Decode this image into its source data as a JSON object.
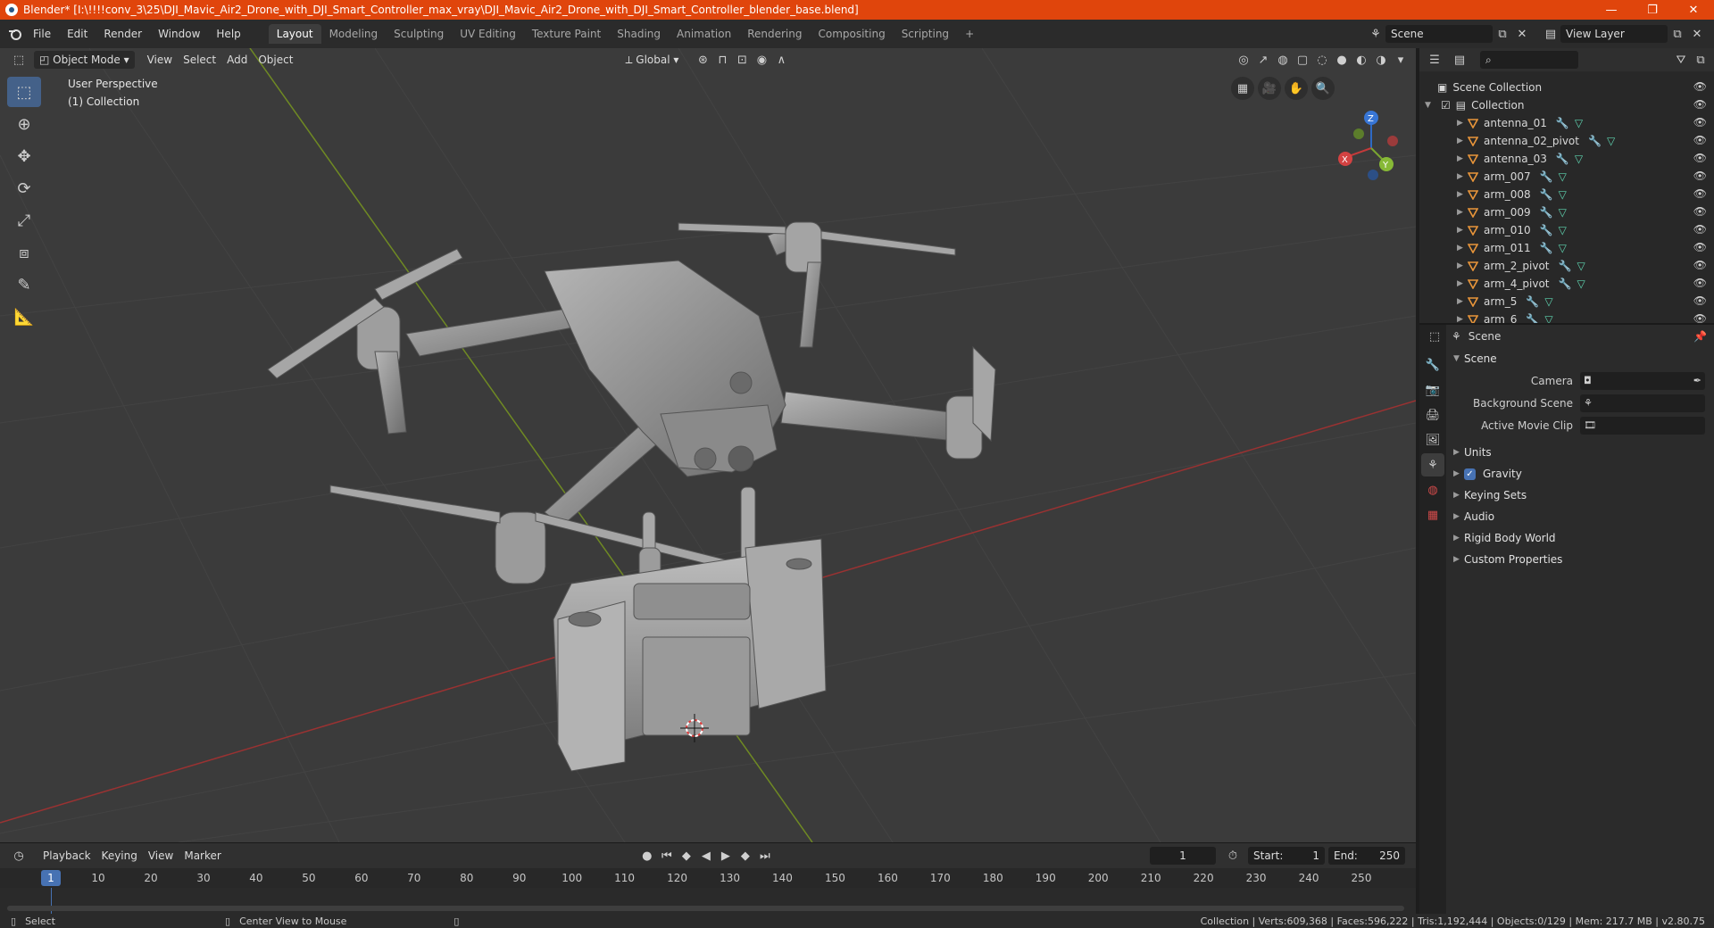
{
  "window": {
    "title": "Blender* [I:\\!!!!conv_3\\25\\DJI_Mavic_Air2_Drone_with_DJI_Smart_Controller_max_vray\\DJI_Mavic_Air2_Drone_with_DJI_Smart_Controller_blender_base.blend]",
    "minimize": "—",
    "maximize": "❐",
    "close": "✕"
  },
  "menu": [
    "File",
    "Edit",
    "Render",
    "Window",
    "Help"
  ],
  "workspaces": [
    "Layout",
    "Modeling",
    "Sculpting",
    "UV Editing",
    "Texture Paint",
    "Shading",
    "Animation",
    "Rendering",
    "Compositing",
    "Scripting"
  ],
  "workspace_add": "+",
  "scene_selector": "Scene",
  "view_layer": "View Layer",
  "viewport": {
    "mode": "Object Mode",
    "menus": [
      "View",
      "Select",
      "Add",
      "Object"
    ],
    "transform": "Global",
    "info_line1": "User Perspective",
    "info_line2": "(1) Collection",
    "gizmo": {
      "x": "X",
      "y": "Y",
      "z": "Z"
    }
  },
  "outliner": {
    "root": "Scene Collection",
    "collection": "Collection",
    "items": [
      "antenna_01",
      "antenna_02_pivot",
      "antenna_03",
      "arm_007",
      "arm_008",
      "arm_009",
      "arm_010",
      "arm_011",
      "arm_2_pivot",
      "arm_4_pivot",
      "arm_5",
      "arm_6"
    ]
  },
  "properties": {
    "header": "Scene",
    "section": "Scene",
    "camera_label": "Camera",
    "background_label": "Background Scene",
    "movieclip_label": "Active Movie Clip",
    "panels": [
      "Units",
      "Gravity",
      "Keying Sets",
      "Audio",
      "Rigid Body World",
      "Custom Properties"
    ]
  },
  "timeline": {
    "menus": [
      "Playback",
      "Keying",
      "View",
      "Marker"
    ],
    "current_frame": "1",
    "start_label": "Start:",
    "start": "1",
    "end_label": "End:",
    "end": "250",
    "ticks": [
      "10",
      "20",
      "30",
      "40",
      "50",
      "60",
      "70",
      "80",
      "90",
      "100",
      "110",
      "120",
      "130",
      "140",
      "150",
      "160",
      "170",
      "180",
      "190",
      "200",
      "210",
      "220",
      "230",
      "240",
      "250"
    ]
  },
  "status": {
    "left": "Select",
    "middle": "Center View to Mouse",
    "right": "Collection | Verts:609,368 | Faces:596,222 | Tris:1,192,444 | Objects:0/129 | Mem: 217.7 MB | v2.80.75"
  }
}
